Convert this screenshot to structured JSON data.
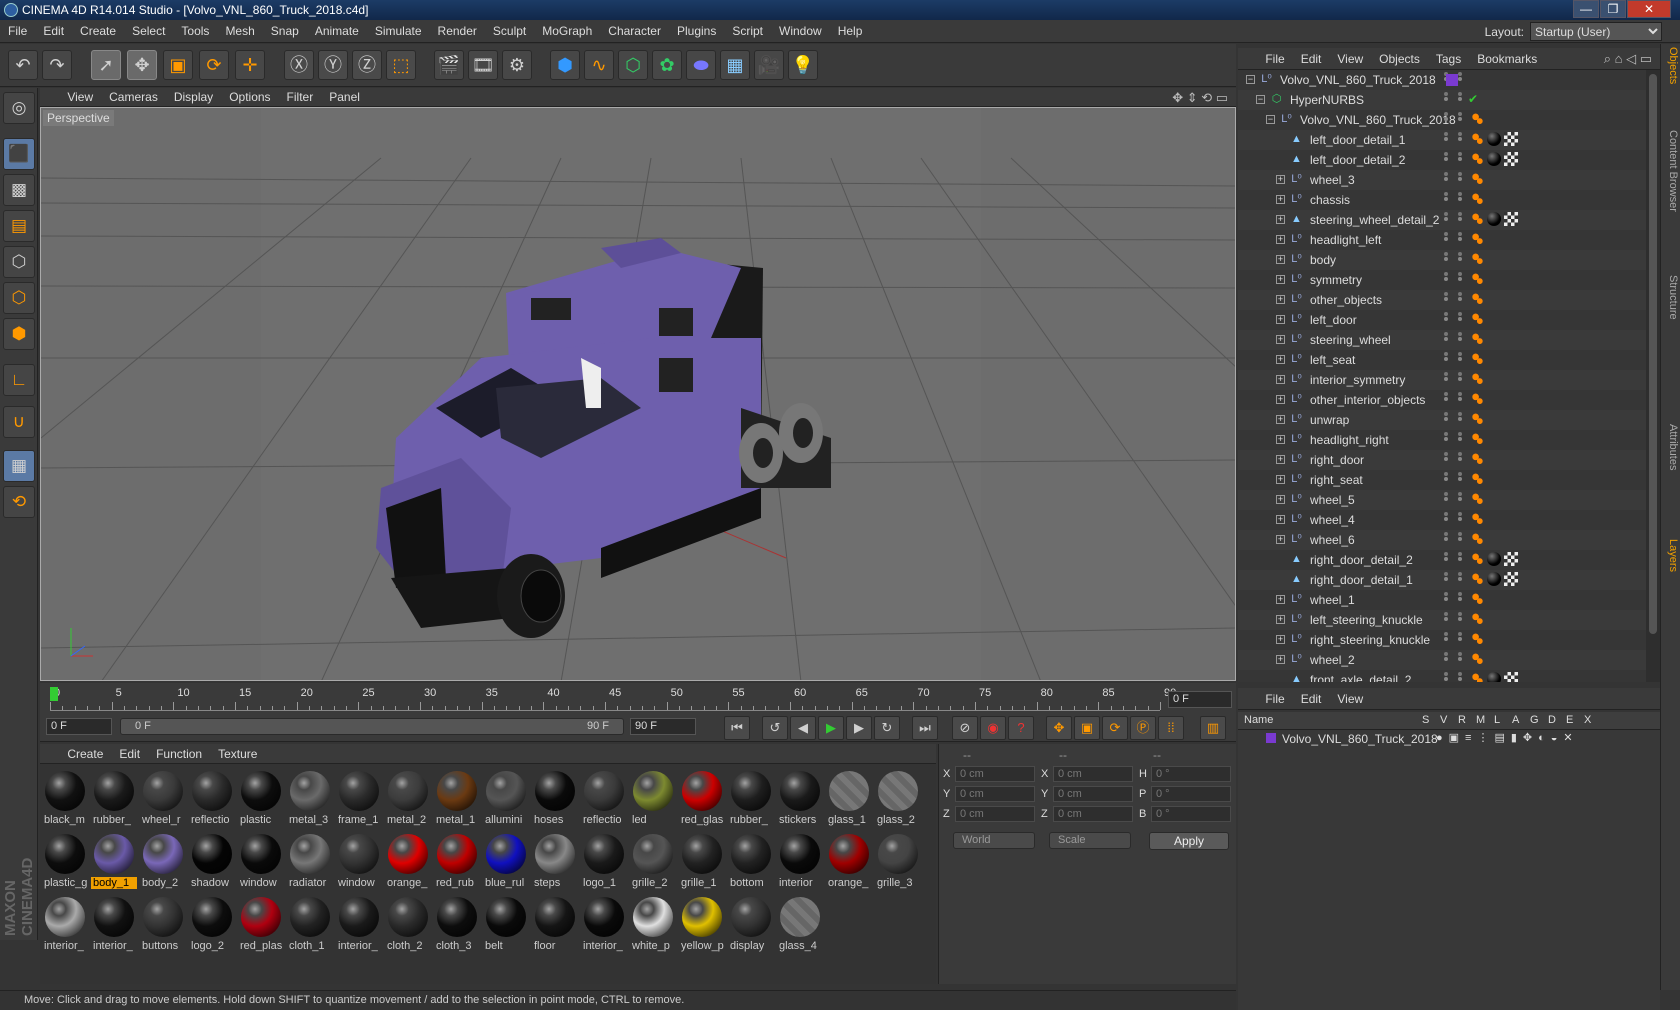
{
  "window": {
    "title": "CINEMA 4D R14.014 Studio - [Volvo_VNL_860_Truck_2018.c4d]",
    "minimize": "—",
    "maximize": "❐",
    "close": "✕"
  },
  "menu": [
    "File",
    "Edit",
    "Create",
    "Select",
    "Tools",
    "Mesh",
    "Snap",
    "Animate",
    "Simulate",
    "Render",
    "Sculpt",
    "MoGraph",
    "Character",
    "Plugins",
    "Script",
    "Window",
    "Help"
  ],
  "layout": {
    "label": "Layout:",
    "value": "Startup (User)"
  },
  "viewport": {
    "menu": [
      "View",
      "Cameras",
      "Display",
      "Options",
      "Filter",
      "Panel"
    ],
    "label": "Perspective"
  },
  "timeline": {
    "ticks": [
      "0",
      "5",
      "10",
      "15",
      "20",
      "25",
      "30",
      "35",
      "40",
      "45",
      "50",
      "55",
      "60",
      "65",
      "70",
      "75",
      "80",
      "85",
      "90"
    ],
    "current_frame": "0 F",
    "start_field": "0 F",
    "range_start": "0 F",
    "range_end": "90 F",
    "end_field": "90 F"
  },
  "materials": {
    "menu": [
      "Create",
      "Edit",
      "Function",
      "Texture"
    ],
    "rows": [
      [
        {
          "name": "black_m",
          "c": "#111"
        },
        {
          "name": "rubber_",
          "c": "#1a1a1a"
        },
        {
          "name": "wheel_r",
          "c": "#3a3a3a"
        },
        {
          "name": "reflectio",
          "c": "#2a2a2a"
        },
        {
          "name": "plastic",
          "c": "#0d0d0d"
        },
        {
          "name": "metal_3",
          "c": "#6a6a6a"
        },
        {
          "name": "frame_1",
          "c": "#2a2a2a"
        },
        {
          "name": "metal_2",
          "c": "#3c3c3c"
        },
        {
          "name": "metal_1",
          "c": "#6b3a12"
        },
        {
          "name": "allumini",
          "c": "#555"
        },
        {
          "name": "hoses",
          "c": "#0a0a0a"
        },
        {
          "name": "reflectio",
          "c": "#3a3a3a"
        },
        {
          "name": "led",
          "c": "#7d8a30"
        },
        {
          "name": "red_glas",
          "c": "#cc0000"
        },
        {
          "name": "rubber_",
          "c": "#1e1e1e"
        },
        {
          "name": "stickers",
          "c": "#1a1a1a"
        },
        {
          "name": "glass_1",
          "c": "#5a5a5a"
        },
        {
          "name": "glass_2",
          "c": "#5a5a5a"
        }
      ],
      [
        {
          "name": "plastic_g",
          "c": "#0d0d0d"
        },
        {
          "name": "body_1",
          "c": "#6a5aa8",
          "sel": true
        },
        {
          "name": "body_2",
          "c": "#7a68b8"
        },
        {
          "name": "shadow",
          "c": "#050505"
        },
        {
          "name": "window",
          "c": "#0a0a0a"
        },
        {
          "name": "radiator",
          "c": "#777"
        },
        {
          "name": "window",
          "c": "#333"
        },
        {
          "name": "orange_",
          "c": "#e00000"
        },
        {
          "name": "red_rub",
          "c": "#c00000"
        },
        {
          "name": "blue_rul",
          "c": "#1010c0"
        },
        {
          "name": "steps",
          "c": "#888"
        },
        {
          "name": "logo_1",
          "c": "#1a1a1a"
        },
        {
          "name": "grille_2",
          "c": "#555"
        },
        {
          "name": "grille_1",
          "c": "#222"
        },
        {
          "name": "bottom",
          "c": "#222"
        },
        {
          "name": "interior",
          "c": "#0a0a0a"
        },
        {
          "name": "orange_",
          "c": "#a00000"
        },
        {
          "name": "grille_3",
          "c": "#444"
        }
      ],
      [
        {
          "name": "interior_",
          "c": "#aaa"
        },
        {
          "name": "interior_",
          "c": "#111"
        },
        {
          "name": "buttons",
          "c": "#333"
        },
        {
          "name": "logo_2",
          "c": "#0d0d0d"
        },
        {
          "name": "red_plas",
          "c": "#b00010"
        },
        {
          "name": "cloth_1",
          "c": "#222"
        },
        {
          "name": "interior_",
          "c": "#1a1a1a"
        },
        {
          "name": "cloth_2",
          "c": "#2a2a2a"
        },
        {
          "name": "cloth_3",
          "c": "#0d0d0d"
        },
        {
          "name": "belt",
          "c": "#0a0a0a"
        },
        {
          "name": "floor",
          "c": "#151515"
        },
        {
          "name": "interior_",
          "c": "#0a0a0a"
        },
        {
          "name": "white_p",
          "c": "#e0e0e0"
        },
        {
          "name": "yellow_p",
          "c": "#e0c000"
        },
        {
          "name": "display",
          "c": "#333"
        },
        {
          "name": "glass_4",
          "c": "#5a5a5a"
        }
      ]
    ]
  },
  "coords": {
    "header": [
      "--",
      "--",
      "--"
    ],
    "rows": [
      {
        "a": "X",
        "av": "0 cm",
        "b": "X",
        "bv": "0 cm",
        "c": "H",
        "cv": "0 °"
      },
      {
        "a": "Y",
        "av": "0 cm",
        "b": "Y",
        "bv": "0 cm",
        "c": "P",
        "cv": "0 °"
      },
      {
        "a": "Z",
        "av": "0 cm",
        "b": "Z",
        "bv": "0 cm",
        "c": "B",
        "cv": "0 °"
      }
    ],
    "mode1": "World",
    "mode2": "Scale",
    "apply": "Apply"
  },
  "objects": {
    "menu": [
      "File",
      "Edit",
      "View",
      "Objects",
      "Tags",
      "Bookmarks"
    ],
    "items": [
      {
        "name": "Volvo_VNL_860_Truck_2018",
        "lvl": 0,
        "exp": "−",
        "icon": "null",
        "tags": []
      },
      {
        "name": "HyperNURBS",
        "lvl": 1,
        "exp": "−",
        "icon": "nurbs",
        "tags": []
      },
      {
        "name": "Volvo_VNL_860_Truck_2018",
        "lvl": 2,
        "exp": "−",
        "icon": "null",
        "tags": [
          "ph"
        ]
      },
      {
        "name": "left_door_detail_1",
        "lvl": 3,
        "exp": "",
        "icon": "poly",
        "tags": [
          "ph",
          "blk",
          "chk"
        ]
      },
      {
        "name": "left_door_detail_2",
        "lvl": 3,
        "exp": "",
        "icon": "poly",
        "tags": [
          "ph",
          "blk",
          "chk"
        ]
      },
      {
        "name": "wheel_3",
        "lvl": 3,
        "exp": "+",
        "icon": "null",
        "tags": [
          "ph"
        ]
      },
      {
        "name": "chassis",
        "lvl": 3,
        "exp": "+",
        "icon": "null",
        "tags": [
          "ph"
        ]
      },
      {
        "name": "steering_wheel_detail_2",
        "lvl": 3,
        "exp": "+",
        "icon": "poly",
        "tags": [
          "ph",
          "blk",
          "chk"
        ]
      },
      {
        "name": "headlight_left",
        "lvl": 3,
        "exp": "+",
        "icon": "null",
        "tags": [
          "ph"
        ]
      },
      {
        "name": "body",
        "lvl": 3,
        "exp": "+",
        "icon": "null",
        "tags": [
          "ph"
        ]
      },
      {
        "name": "symmetry",
        "lvl": 3,
        "exp": "+",
        "icon": "null",
        "tags": [
          "ph"
        ]
      },
      {
        "name": "other_objects",
        "lvl": 3,
        "exp": "+",
        "icon": "null",
        "tags": [
          "ph"
        ]
      },
      {
        "name": "left_door",
        "lvl": 3,
        "exp": "+",
        "icon": "null",
        "tags": [
          "ph"
        ]
      },
      {
        "name": "steering_wheel",
        "lvl": 3,
        "exp": "+",
        "icon": "null",
        "tags": [
          "ph"
        ]
      },
      {
        "name": "left_seat",
        "lvl": 3,
        "exp": "+",
        "icon": "null",
        "tags": [
          "ph"
        ]
      },
      {
        "name": "interior_symmetry",
        "lvl": 3,
        "exp": "+",
        "icon": "null",
        "tags": [
          "ph"
        ]
      },
      {
        "name": "other_interior_objects",
        "lvl": 3,
        "exp": "+",
        "icon": "null",
        "tags": [
          "ph"
        ]
      },
      {
        "name": "unwrap",
        "lvl": 3,
        "exp": "+",
        "icon": "null",
        "tags": [
          "ph"
        ]
      },
      {
        "name": "headlight_right",
        "lvl": 3,
        "exp": "+",
        "icon": "null",
        "tags": [
          "ph"
        ]
      },
      {
        "name": "right_door",
        "lvl": 3,
        "exp": "+",
        "icon": "null",
        "tags": [
          "ph"
        ]
      },
      {
        "name": "right_seat",
        "lvl": 3,
        "exp": "+",
        "icon": "null",
        "tags": [
          "ph"
        ]
      },
      {
        "name": "wheel_5",
        "lvl": 3,
        "exp": "+",
        "icon": "null",
        "tags": [
          "ph"
        ]
      },
      {
        "name": "wheel_4",
        "lvl": 3,
        "exp": "+",
        "icon": "null",
        "tags": [
          "ph"
        ]
      },
      {
        "name": "wheel_6",
        "lvl": 3,
        "exp": "+",
        "icon": "null",
        "tags": [
          "ph"
        ]
      },
      {
        "name": "right_door_detail_2",
        "lvl": 3,
        "exp": "",
        "icon": "poly",
        "tags": [
          "ph",
          "blk",
          "chk"
        ]
      },
      {
        "name": "right_door_detail_1",
        "lvl": 3,
        "exp": "",
        "icon": "poly",
        "tags": [
          "ph",
          "blk",
          "chk"
        ]
      },
      {
        "name": "wheel_1",
        "lvl": 3,
        "exp": "+",
        "icon": "null",
        "tags": [
          "ph"
        ]
      },
      {
        "name": "left_steering_knuckle",
        "lvl": 3,
        "exp": "+",
        "icon": "null",
        "tags": [
          "ph"
        ]
      },
      {
        "name": "right_steering_knuckle",
        "lvl": 3,
        "exp": "+",
        "icon": "null",
        "tags": [
          "ph"
        ]
      },
      {
        "name": "wheel_2",
        "lvl": 3,
        "exp": "+",
        "icon": "null",
        "tags": [
          "ph"
        ]
      },
      {
        "name": "front_axle_detail_2",
        "lvl": 3,
        "exp": "",
        "icon": "poly",
        "tags": [
          "ph",
          "blk",
          "chk"
        ]
      }
    ]
  },
  "layers": {
    "menu": [
      "File",
      "Edit",
      "View"
    ],
    "columns": [
      "Name",
      "S",
      "V",
      "R",
      "M",
      "L",
      "A",
      "G",
      "D",
      "E",
      "X"
    ],
    "item": "Volvo_VNL_860_Truck_2018",
    "item_color": "#7a3ad0"
  },
  "right_tabs": [
    "Objects",
    "Content Browser",
    "Structure",
    "Attributes",
    "Layers"
  ],
  "status": "Move: Click and drag to move elements. Hold down SHIFT to quantize movement / add to the selection in point mode, CTRL to remove.",
  "colors": {
    "accent": "#f0a000",
    "selection": "#5b7aa5",
    "truck": "#6e5fad"
  }
}
